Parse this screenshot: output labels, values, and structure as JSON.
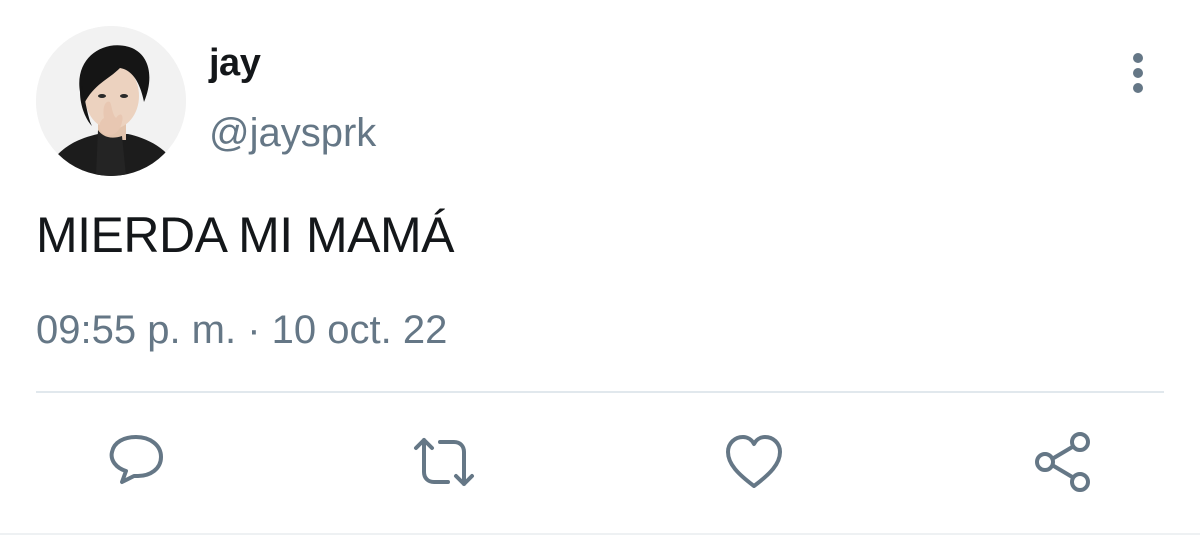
{
  "tweet": {
    "author": {
      "display_name": "jay",
      "handle": "@jaysprk",
      "avatar_icon": "profile-photo"
    },
    "text": "MIERDA MI MAMÁ",
    "timestamp": "09:55 p. m. · 10 oct. 22",
    "menu_icon": "more-vertical-icon",
    "actions": [
      {
        "id": "reply",
        "icon": "reply-icon"
      },
      {
        "id": "retweet",
        "icon": "retweet-icon"
      },
      {
        "id": "like",
        "icon": "heart-icon"
      },
      {
        "id": "share",
        "icon": "share-icon"
      }
    ],
    "colors": {
      "primary_text": "#14171a",
      "secondary_text": "#657786",
      "icon": "#657786",
      "divider": "#e1e8ed"
    }
  }
}
